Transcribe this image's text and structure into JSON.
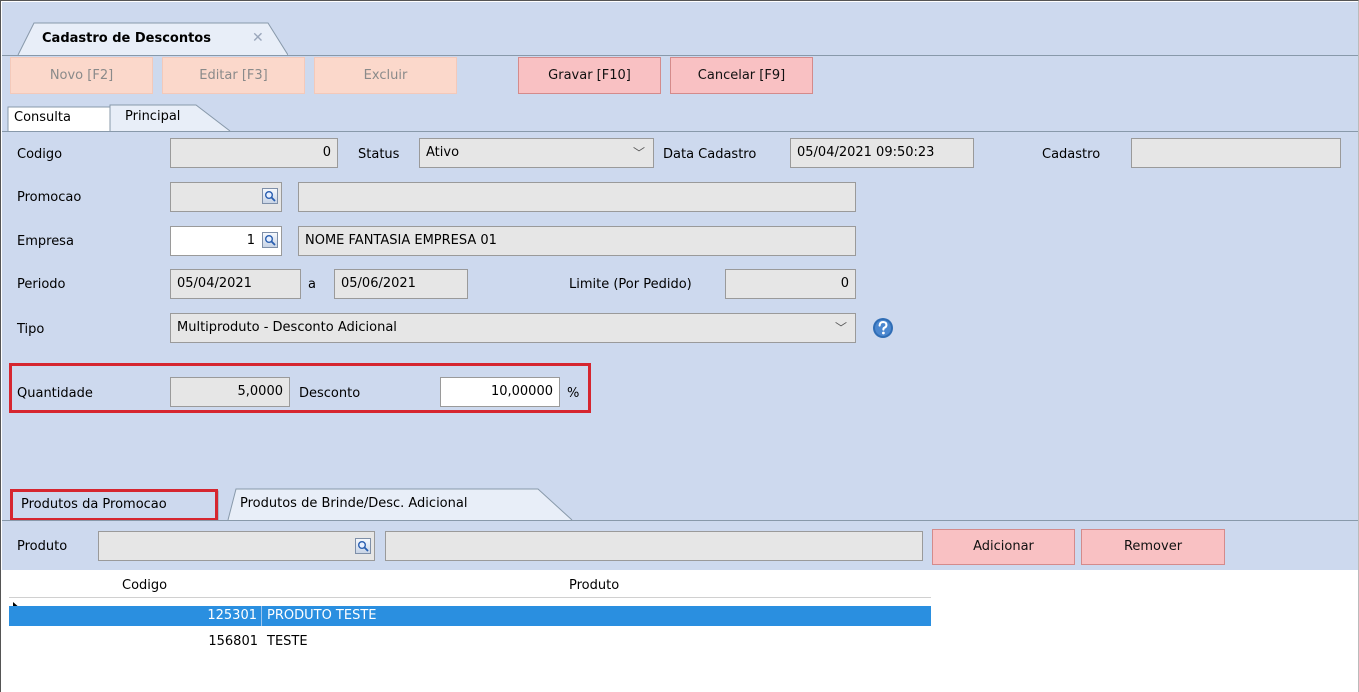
{
  "document_tab": {
    "title": "Cadastro de Descontos",
    "close": "✕"
  },
  "toolbar": {
    "novo": "Novo [F2]",
    "editar": "Editar [F3]",
    "excluir": "Excluir",
    "gravar": "Gravar [F10]",
    "cancelar": "Cancelar [F9]"
  },
  "tabs": {
    "consulta": "Consulta",
    "principal": "Principal"
  },
  "form": {
    "codigo_label": "Codigo",
    "codigo_value": "0",
    "status_label": "Status",
    "status_value": "Ativo",
    "data_cadastro_label": "Data Cadastro",
    "data_cadastro_value": "05/04/2021 09:50:23",
    "cadastro_label": "Cadastro",
    "cadastro_value": "",
    "promocao_label": "Promocao",
    "promocao_code": "",
    "promocao_name": "",
    "empresa_label": "Empresa",
    "empresa_code": "1",
    "empresa_name": "NOME FANTASIA EMPRESA 01",
    "periodo_label": "Periodo",
    "periodo_start": "05/04/2021",
    "periodo_sep": "a",
    "periodo_end": "05/06/2021",
    "limite_label": "Limite (Por Pedido)",
    "limite_value": "0",
    "tipo_label": "Tipo",
    "tipo_value": "Multiproduto - Desconto Adicional",
    "quantidade_label": "Quantidade",
    "quantidade_value": "5,0000",
    "desconto_label": "Desconto",
    "desconto_value": "10,00000",
    "desconto_unit": "%"
  },
  "subtabs": {
    "produtos_promocao": "Produtos da Promocao",
    "produtos_brinde": "Produtos de Brinde/Desc. Adicional"
  },
  "produto_bar": {
    "label": "Produto",
    "code": "",
    "name": "",
    "adicionar": "Adicionar",
    "remover": "Remover"
  },
  "grid": {
    "columns": [
      "Codigo",
      "Produto"
    ],
    "rows": [
      {
        "codigo": "125301",
        "produto": "PRODUTO TESTE"
      },
      {
        "codigo": "156801",
        "produto": "TESTE"
      }
    ]
  },
  "colors": {
    "panel_bg": "#cdd9ee",
    "disabled_button": "#fbd8cb",
    "active_button": "#f9c1c3",
    "highlight_box": "#d6262f",
    "selected_row": "#2a8fe0"
  }
}
